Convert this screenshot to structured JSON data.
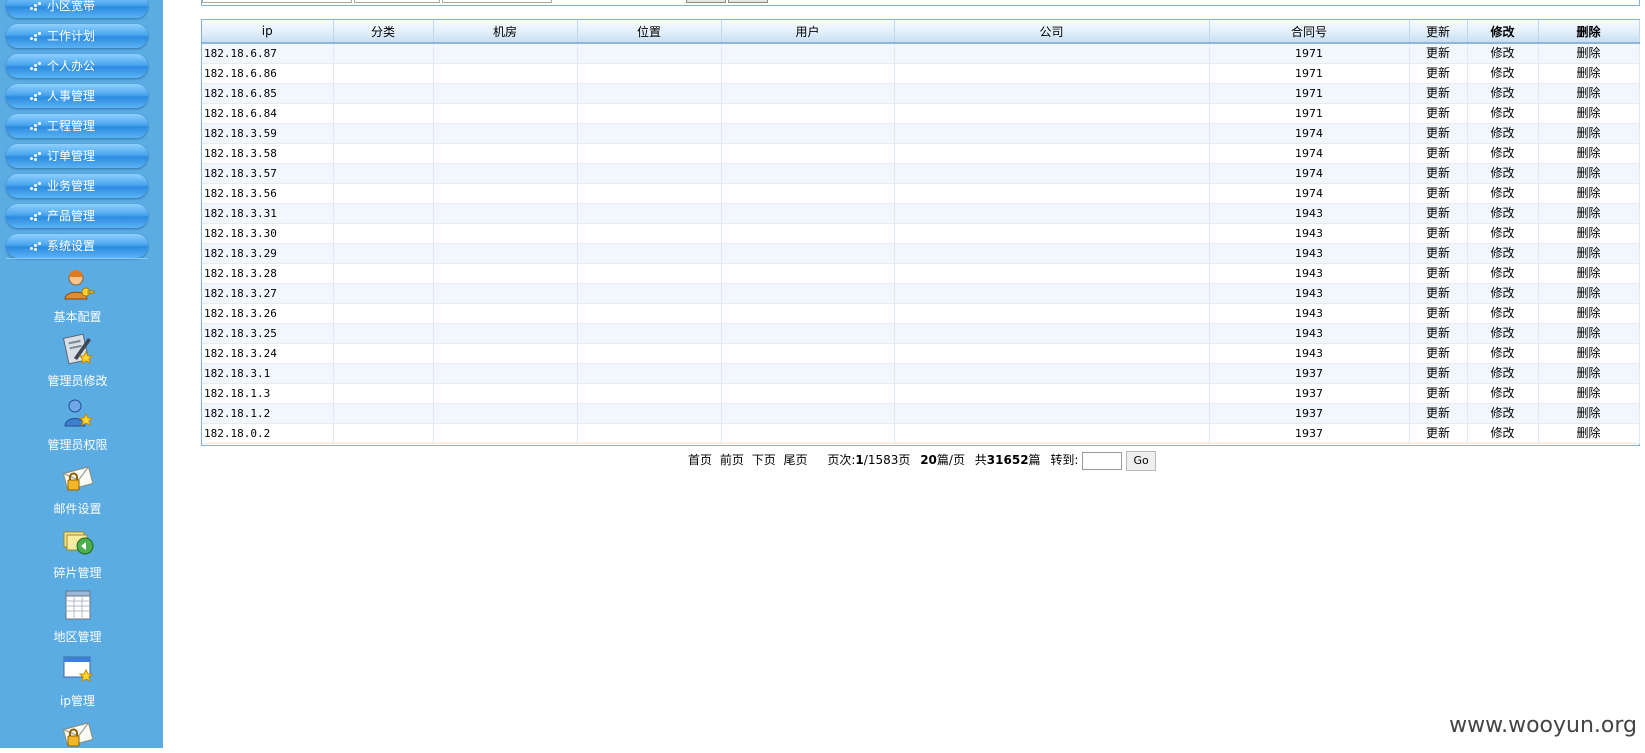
{
  "sidebar": {
    "menu": [
      "小区宽带",
      "工作计划",
      "个人办公",
      "人事管理",
      "工程管理",
      "订单管理",
      "业务管理",
      "产品管理",
      "系统设置"
    ],
    "tools": [
      {
        "label": "基本配置",
        "icon": "user-key-icon"
      },
      {
        "label": "管理员修改",
        "icon": "clipboard-edit-icon"
      },
      {
        "label": "管理员权限",
        "icon": "user-star-icon"
      },
      {
        "label": "邮件设置",
        "icon": "mail-lock-icon"
      },
      {
        "label": "碎片管理",
        "icon": "folder-recycle-icon"
      },
      {
        "label": "地区管理",
        "icon": "sheet-table-icon"
      },
      {
        "label": "ip管理",
        "icon": "window-star-icon"
      }
    ]
  },
  "table": {
    "headers": [
      "ip",
      "分类",
      "机房",
      "位置",
      "用户",
      "公司",
      "合同号",
      "更新",
      "修改",
      "删除"
    ],
    "action_labels": {
      "refresh": "更新",
      "edit": "修改",
      "delete": "删除"
    },
    "rows": [
      {
        "ip": "182.18.6.87",
        "contract": "1971"
      },
      {
        "ip": "182.18.6.86",
        "contract": "1971"
      },
      {
        "ip": "182.18.6.85",
        "contract": "1971"
      },
      {
        "ip": "182.18.6.84",
        "contract": "1971"
      },
      {
        "ip": "182.18.3.59",
        "contract": "1974"
      },
      {
        "ip": "182.18.3.58",
        "contract": "1974"
      },
      {
        "ip": "182.18.3.57",
        "contract": "1974"
      },
      {
        "ip": "182.18.3.56",
        "contract": "1974"
      },
      {
        "ip": "182.18.3.31",
        "contract": "1943"
      },
      {
        "ip": "182.18.3.30",
        "contract": "1943"
      },
      {
        "ip": "182.18.3.29",
        "contract": "1943"
      },
      {
        "ip": "182.18.3.28",
        "contract": "1943"
      },
      {
        "ip": "182.18.3.27",
        "contract": "1943"
      },
      {
        "ip": "182.18.3.26",
        "contract": "1943"
      },
      {
        "ip": "182.18.3.25",
        "contract": "1943"
      },
      {
        "ip": "182.18.3.24",
        "contract": "1943"
      },
      {
        "ip": "182.18.3.1",
        "contract": "1937"
      },
      {
        "ip": "182.18.1.3",
        "contract": "1937"
      },
      {
        "ip": "182.18.1.2",
        "contract": "1937"
      },
      {
        "ip": "182.18.0.2",
        "contract": "1937"
      }
    ]
  },
  "pager": {
    "first": "首页",
    "prev": "前页",
    "next": "下页",
    "last": "尾页",
    "page_prefix": "页次:",
    "current": "1",
    "total_pages": "/1583页",
    "per_page": "20",
    "per_page_suffix": "篇/页",
    "total_prefix": "共",
    "total": "31652",
    "total_suffix": "篇",
    "goto_label": "转到:",
    "goto_value": "",
    "go": "Go"
  },
  "watermark": "www.wooyun.org"
}
